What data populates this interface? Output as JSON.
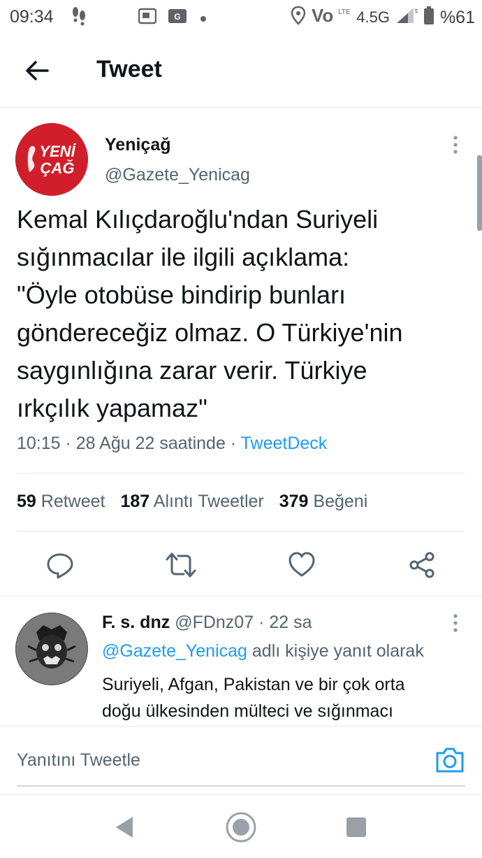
{
  "status_bar": {
    "time": "09:34",
    "network": "4.5G",
    "battery": "%61",
    "icons": [
      "footsteps-icon",
      "screen-icon",
      "ge-icon",
      "dot-icon",
      "location-icon",
      "volte-icon",
      "signal-icon",
      "battery-icon"
    ]
  },
  "header": {
    "title": "Tweet",
    "back_icon": "arrow-left-icon"
  },
  "tweet": {
    "author_name": "Yeniçağ",
    "author_handle": "@Gazete_Yenicag",
    "avatar_text": [
      "YENİ",
      "ÇAĞ"
    ],
    "text": "Kemal Kılıçdaroğlu'ndan Suriyeli\nsığınmacılar ile ilgili açıklama:\n\"Öyle otobüse bindirip bunları\ngöndereceğiz olmaz. O Türkiye'nin\nsaygınlığına zarar verir. Türkiye\nırkçılık yapamaz\"",
    "meta_time": "10:15 · 28 Ağu 22 saatinde · ",
    "source": "TweetDeck",
    "stats": {
      "retweets_count": "59",
      "retweets_label": "Retweet",
      "quotes_count": "187",
      "quotes_label": "Alıntı Tweetler",
      "likes_count": "379",
      "likes_label": "Beğeni"
    },
    "actions": [
      "reply-icon",
      "retweet-icon",
      "like-icon",
      "share-icon"
    ]
  },
  "reply": {
    "author_name": "F. s. dnz",
    "author_handle": "@FDnz07",
    "time": " · 22 sa",
    "replying_to": "@Gazete_Yenicag",
    "replying_suffix": " adlı kişiye yanıt olarak",
    "text": "Suriyeli, Afgan, Pakistan ve bir çok orta\ndoğu ülkesinden mülteci ve sığınmacı"
  },
  "composer": {
    "placeholder": "Yanıtını Tweetle"
  },
  "colors": {
    "accent": "#1d9bf0",
    "text": "#0f1419",
    "secondary": "#536471",
    "brand_red": "#d01f2a"
  }
}
